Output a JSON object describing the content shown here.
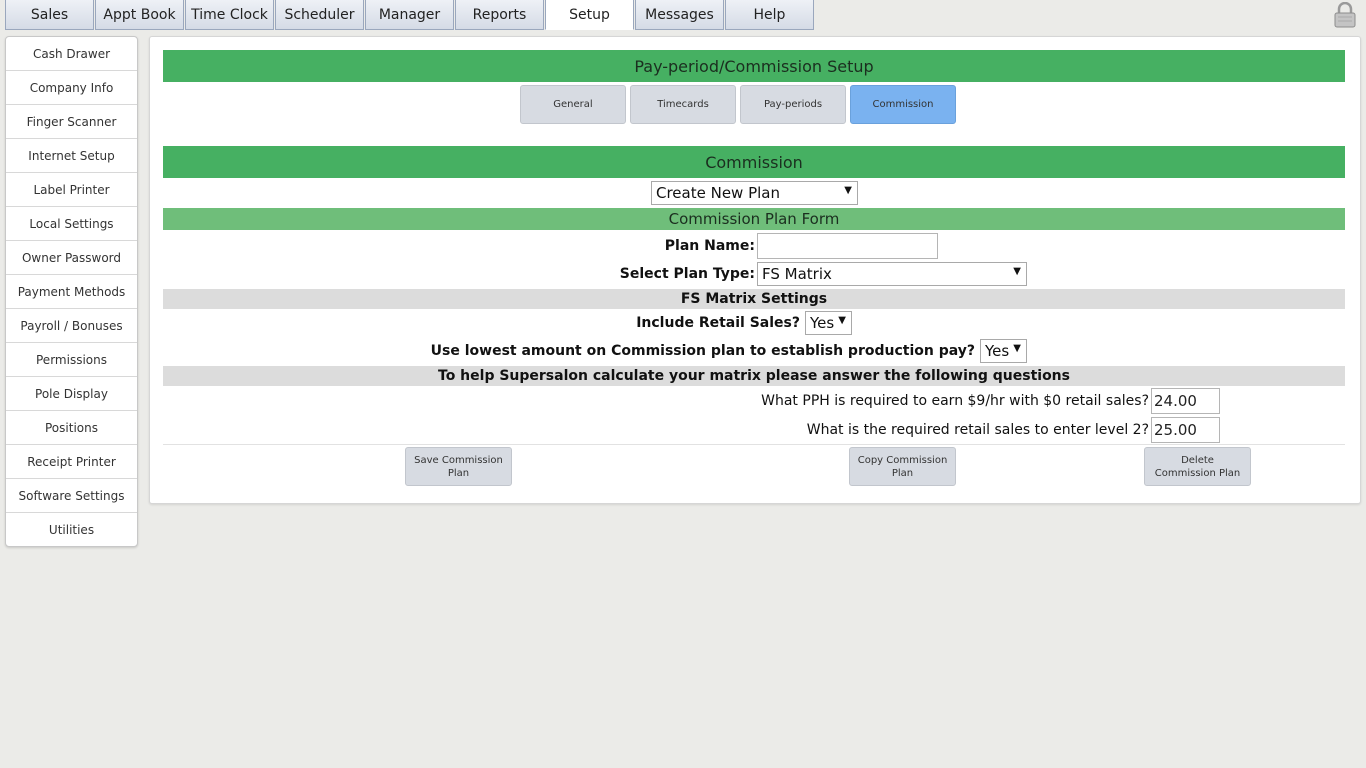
{
  "topnav": {
    "tabs": [
      {
        "label": "Sales"
      },
      {
        "label": "Appt Book"
      },
      {
        "label": "Time Clock"
      },
      {
        "label": "Scheduler"
      },
      {
        "label": "Manager"
      },
      {
        "label": "Reports"
      },
      {
        "label": "Setup",
        "active": true
      },
      {
        "label": "Messages"
      },
      {
        "label": "Help"
      }
    ],
    "lock_icon": "lock-icon"
  },
  "sidebar": {
    "items": [
      {
        "label": "Cash Drawer"
      },
      {
        "label": "Company Info"
      },
      {
        "label": "Finger Scanner"
      },
      {
        "label": "Internet Setup"
      },
      {
        "label": "Label Printer"
      },
      {
        "label": "Local Settings"
      },
      {
        "label": "Owner Password"
      },
      {
        "label": "Payment Methods"
      },
      {
        "label": "Payroll / Bonuses"
      },
      {
        "label": "Permissions"
      },
      {
        "label": "Pole Display"
      },
      {
        "label": "Positions"
      },
      {
        "label": "Receipt Printer"
      },
      {
        "label": "Software Settings"
      },
      {
        "label": "Utilities"
      }
    ]
  },
  "main": {
    "title": "Pay-period/Commission Setup",
    "subtabs": [
      {
        "label": "General"
      },
      {
        "label": "Timecards"
      },
      {
        "label": "Pay-periods"
      },
      {
        "label": "Commission",
        "active": true
      }
    ],
    "commission_header": "Commission",
    "plan_select": "Create New Plan",
    "form_header": "Commission Plan Form",
    "plan_name_label": "Plan Name:",
    "plan_name_value": "",
    "plan_type_label": "Select Plan Type:",
    "plan_type_value": "FS Matrix",
    "fs_settings_header": "FS Matrix Settings",
    "include_retail_label": "Include Retail Sales?",
    "include_retail_value": "Yes",
    "lowest_amount_label": "Use lowest amount on Commission plan to establish production pay?",
    "lowest_amount_value": "Yes",
    "questions_header": "To help Supersalon calculate your matrix please answer the following questions",
    "pph_label": "What PPH is required to earn $9/hr with $0 retail sales?",
    "pph_value": "24.00",
    "retail_level_label": "What is the required retail sales to enter level 2?",
    "retail_level_value": "25.00",
    "buttons": {
      "save": "Save Commission Plan",
      "copy": "Copy Commission Plan",
      "delete": "Delete Commission Plan"
    }
  },
  "colors": {
    "header_green": "#46b062",
    "subheader_green": "#6fbe7a",
    "active_tab_blue": "#7ab2f0"
  }
}
